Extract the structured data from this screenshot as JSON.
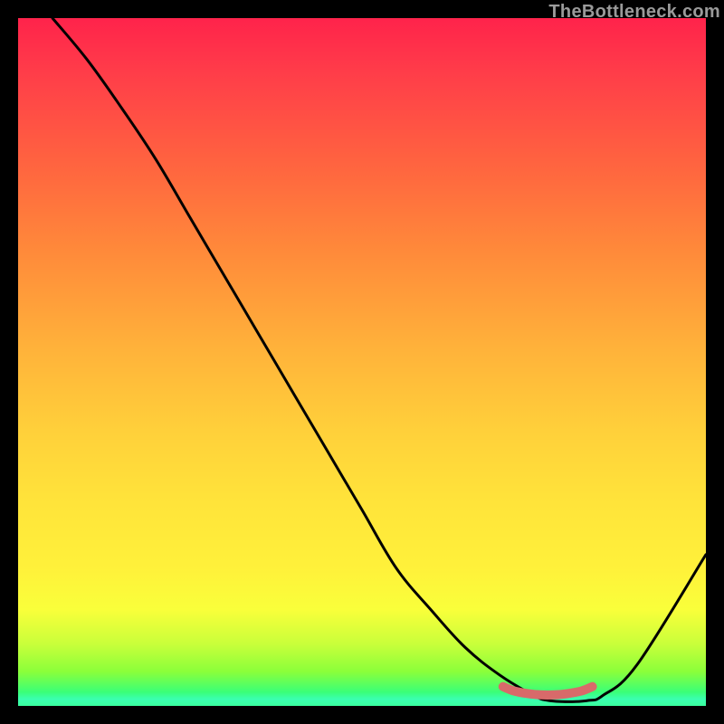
{
  "watermark": "TheBottleneck.com",
  "chart_data": {
    "type": "line",
    "title": "",
    "xlabel": "",
    "ylabel": "",
    "xlim": [
      0,
      100
    ],
    "ylim": [
      0,
      100
    ],
    "grid": false,
    "series": [
      {
        "name": "bottleneck-curve",
        "x": [
          5,
          10,
          15,
          20,
          25,
          30,
          35,
          40,
          45,
          50,
          55,
          60,
          65,
          70,
          75,
          77,
          80,
          83,
          85,
          90,
          100
        ],
        "y": [
          100,
          94,
          87,
          79.5,
          71,
          62.5,
          54,
          45.5,
          37,
          28.5,
          20,
          14,
          8.5,
          4.5,
          1.5,
          0.8,
          0.6,
          0.8,
          1.5,
          6,
          22
        ]
      },
      {
        "name": "highlight-band",
        "x": [
          70.5,
          72,
          74,
          76,
          78,
          80,
          82,
          83.5
        ],
        "y": [
          2.8,
          2.2,
          1.8,
          1.6,
          1.6,
          1.8,
          2.2,
          2.8
        ]
      }
    ],
    "colors": {
      "curve": "#000000",
      "highlight": "#d86a6a"
    }
  }
}
